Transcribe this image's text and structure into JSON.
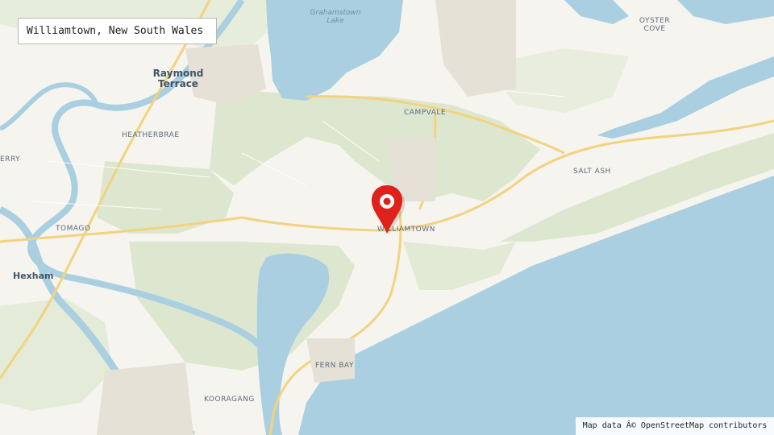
{
  "title_box": {
    "text": "Williamtown, New South Wales"
  },
  "attribution": {
    "text": "Map data Â© OpenStreetMap contributors"
  },
  "labels": {
    "lake": "Grahamstown\nLake",
    "oyster_cove": "OYSTER\nCOVE",
    "raymond_terrace": "Raymond\nTerrace",
    "campvale": "CAMPVALE",
    "heatherbrae": "HEATHERBRAE",
    "salt_ash": "SALT ASH",
    "ferry": "ERRY",
    "tomago": "TOMAGO",
    "williamtown": "WILLIAMTOWN",
    "hexham": "Hexham",
    "fern_bay": "FERN BAY",
    "kooragang": "KOORAGANG"
  },
  "marker": {
    "icon": "map-pin-icon",
    "color": "#e0201a"
  },
  "colors": {
    "land": "#f6f4ee",
    "water": "#a9cfe0",
    "green": "#dfe8d2",
    "road": "#f6dc97"
  }
}
